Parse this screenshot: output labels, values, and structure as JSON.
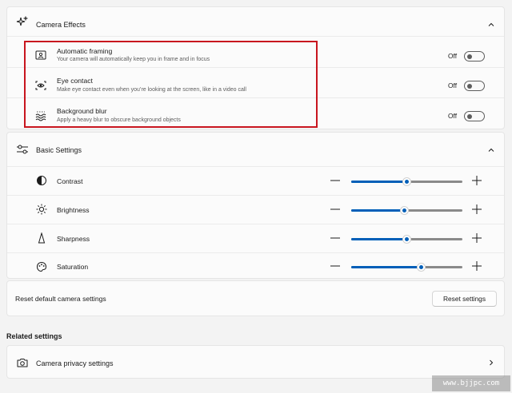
{
  "camera_effects": {
    "title": "Camera Effects",
    "icon": "sparkle-icon",
    "items": [
      {
        "title": "Automatic framing",
        "description": "Your camera will automatically keep you in frame and in focus",
        "state": "Off",
        "icon": "framing-icon"
      },
      {
        "title": "Eye contact",
        "description": "Make eye contact even when you’re looking at the screen, like in a video call",
        "state": "Off",
        "icon": "eye-contact-icon"
      },
      {
        "title": "Background blur",
        "description": "Apply a heavy blur to obscure background objects",
        "state": "Off",
        "icon": "background-blur-icon"
      }
    ]
  },
  "basic_settings": {
    "title": "Basic Settings",
    "icon": "sliders-icon",
    "sliders": [
      {
        "label": "Contrast",
        "value_fraction": 0.5,
        "icon": "contrast-icon"
      },
      {
        "label": "Brightness",
        "value_fraction": 0.48,
        "icon": "brightness-icon"
      },
      {
        "label": "Sharpness",
        "value_fraction": 0.5,
        "icon": "sharpness-icon"
      },
      {
        "label": "Saturation",
        "value_fraction": 0.63,
        "icon": "saturation-icon"
      }
    ]
  },
  "reset": {
    "label": "Reset default camera settings",
    "button": "Reset settings"
  },
  "related_settings": {
    "title": "Related settings",
    "items": [
      {
        "label": "Camera privacy settings",
        "icon": "camera-icon"
      }
    ]
  },
  "watermark": "www.bjjpc.com",
  "colors": {
    "accent": "#005fb8",
    "highlight_box": "#c8151e",
    "background": "#f3f3f3",
    "card": "#fbfbfb"
  }
}
